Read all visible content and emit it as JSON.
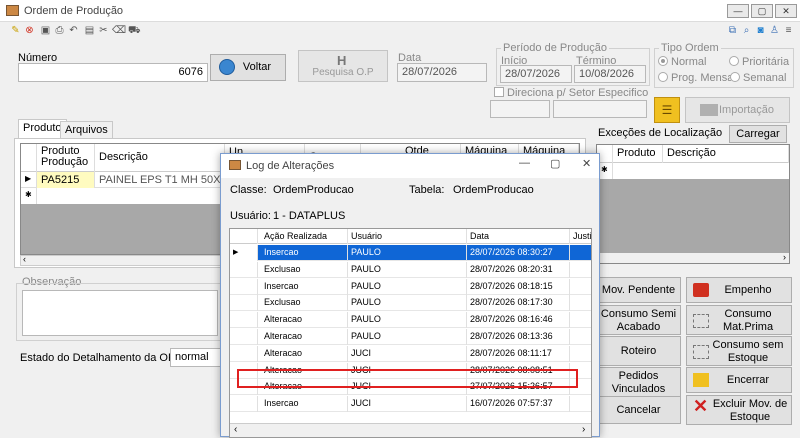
{
  "window": {
    "title": "Ordem de Produção"
  },
  "toolbar_icons": [
    "new-icon",
    "delete-icon",
    "save-icon",
    "print-icon",
    "undo-icon",
    "view-icon",
    "tools-icon",
    "eraser-icon",
    "car-icon"
  ],
  "header": {
    "numero_label": "Número",
    "numero_value": "6076",
    "voltar_label": "Voltar",
    "pesquisa_label": "Pesquisa O.P",
    "data_label": "Data",
    "data_value": "28/07/2026",
    "periodo_label": "Período de Produção",
    "inicio_label": "Início",
    "inicio_value": "28/07/2026",
    "termino_label": "Término",
    "termino_value": "10/08/2026",
    "tipo_label": "Tipo Ordem",
    "tipo_normal": "Normal",
    "tipo_prioritaria": "Prioritária",
    "tipo_mensal": "Prog. Mensal",
    "tipo_semanal": "Semanal",
    "direciona_label": "Direciona p/ Setor Especifico",
    "importacao_label": "Importação"
  },
  "tabs": [
    {
      "label": "Produto"
    },
    {
      "label": "Arquivos"
    }
  ],
  "product_grid": {
    "headers": [
      "Produto Produção",
      "Descrição",
      "Un",
      "Cor",
      "Qtde Produção",
      "Máquina",
      "Máquina"
    ],
    "row": {
      "produto": "PA5215",
      "descricao": "PAINEL EPS T1 MH 50X150"
    }
  },
  "excecoes": {
    "label": "Exceções de Localização",
    "carregar": "Carregar",
    "headers": [
      "Produto",
      "Descrição"
    ]
  },
  "observacao_label": "Observação",
  "estado": {
    "label": "Estado do Detalhamento da OP:",
    "value": "normal"
  },
  "side_buttons": {
    "mov_pendente": "Mov. Pendente",
    "empenho": "Empenho",
    "consumo_semi": "Consumo Semi Acabado",
    "consumo_mat": "Consumo Mat.Prima",
    "roteiro": "Roteiro",
    "consumo_sem": "Consumo sem Estoque",
    "pedidos": "Pedidos Vinculados",
    "encerrar": "Encerrar",
    "cancelar": "Cancelar",
    "excluir": "Excluir Mov. de Estoque"
  },
  "dialog": {
    "title": "Log de Alterações",
    "classe_label": "Classe:",
    "classe_value": "OrdemProducao",
    "tabela_label": "Tabela:",
    "tabela_value": "OrdemProducao",
    "usuario_label": "Usuário:",
    "usuario_value": "1 - DATAPLUS",
    "headers": [
      "Ação Realizada",
      "Usuário",
      "Data",
      "Justific"
    ],
    "rows": [
      {
        "acao": "Insercao",
        "usuario": "PAULO",
        "data": "28/07/2026 08:30:27"
      },
      {
        "acao": "Exclusao",
        "usuario": "PAULO",
        "data": "28/07/2026 08:20:31"
      },
      {
        "acao": "Insercao",
        "usuario": "PAULO",
        "data": "28/07/2026 08:18:15"
      },
      {
        "acao": "Exclusao",
        "usuario": "PAULO",
        "data": "28/07/2026 08:17:30"
      },
      {
        "acao": "Alteracao",
        "usuario": "PAULO",
        "data": "28/07/2026 08:16:46"
      },
      {
        "acao": "Alteracao",
        "usuario": "PAULO",
        "data": "28/07/2026 08:13:36"
      },
      {
        "acao": "Alteracao",
        "usuario": "JUCI",
        "data": "28/07/2026 08:11:17"
      },
      {
        "acao": "Alteracao",
        "usuario": "JUCI",
        "data": "28/07/2026 08:08:51"
      },
      {
        "acao": "Alteracao",
        "usuario": "JUCI",
        "data": "27/07/2026 15:26:57"
      },
      {
        "acao": "Insercao",
        "usuario": "JUCI",
        "data": "16/07/2026 07:57:37"
      }
    ]
  },
  "colors": {
    "selection": "#0f66d6",
    "highlight": "#e02020",
    "grid_bg": "#a8a8a8"
  }
}
